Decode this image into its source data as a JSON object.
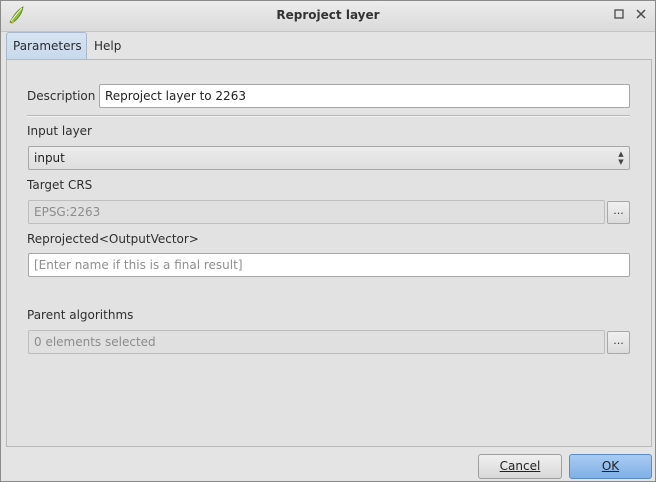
{
  "window": {
    "title": "Reproject layer"
  },
  "tabs": [
    {
      "label": "Parameters",
      "active": true
    },
    {
      "label": "Help",
      "active": false
    }
  ],
  "form": {
    "description_label": "Description",
    "description_value": "Reproject layer to 2263",
    "input_layer_label": "Input layer",
    "input_layer_value": "input",
    "target_crs_label": "Target CRS",
    "target_crs_value": "EPSG:2263",
    "target_crs_button": "...",
    "output_label": "Reprojected<OutputVector>",
    "output_placeholder": "[Enter name if this is a final result]",
    "parent_algorithms_label": "Parent algorithms",
    "parent_algorithms_value": "0 elements selected",
    "parent_algorithms_button": "..."
  },
  "buttons": {
    "cancel": "Cancel",
    "ok": "OK"
  },
  "icons": {
    "app": "qgis-logo-icon",
    "restore": "restore-icon",
    "close": "close-icon"
  },
  "colors": {
    "primary_button": "#7fb0e6",
    "active_tab": "#c8d9ec"
  }
}
